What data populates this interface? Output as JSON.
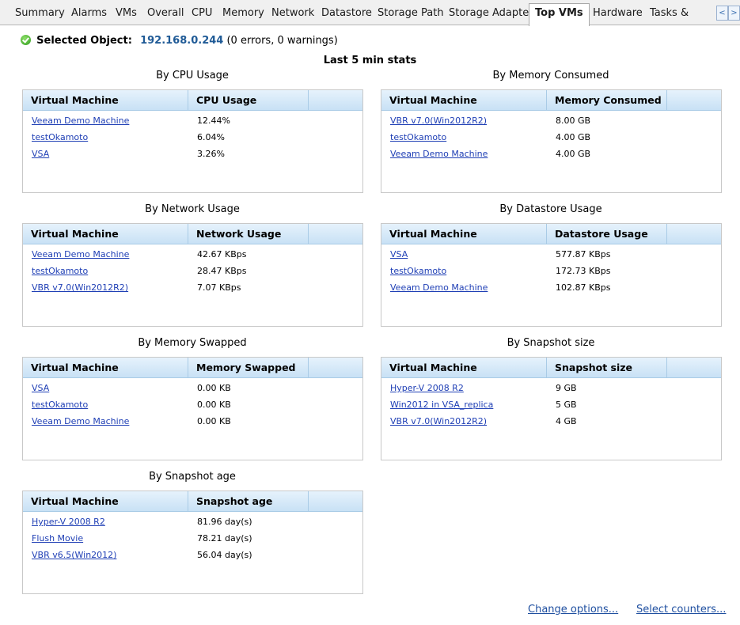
{
  "tabs": [
    {
      "label": "Summary",
      "active": false
    },
    {
      "label": "Alarms",
      "active": false
    },
    {
      "label": "VMs",
      "active": false
    },
    {
      "label": "Overall",
      "active": false
    },
    {
      "label": "CPU",
      "active": false
    },
    {
      "label": "Memory",
      "active": false
    },
    {
      "label": "Network",
      "active": false
    },
    {
      "label": "Datastore",
      "active": false
    },
    {
      "label": "Storage Path",
      "active": false
    },
    {
      "label": "Storage Adapter",
      "active": false
    },
    {
      "label": "Top VMs",
      "active": true
    },
    {
      "label": "Hardware",
      "active": false
    },
    {
      "label": "Tasks &",
      "active": false
    }
  ],
  "scroll": {
    "left": "<",
    "right": ">"
  },
  "selected_object": {
    "label": "Selected Object:",
    "ip": "192.168.0.244",
    "status": "(0 errors, 0 warnings)"
  },
  "stats_title": "Last 5 min stats",
  "panels": [
    {
      "title": "By CPU Usage",
      "col1": "Virtual Machine",
      "col2": "CPU Usage",
      "rows": [
        {
          "vm": "Veeam Demo Machine",
          "value": "12.44%"
        },
        {
          "vm": "testOkamoto",
          "value": "6.04%"
        },
        {
          "vm": "VSA",
          "value": "3.26%"
        }
      ]
    },
    {
      "title": "By Memory Consumed",
      "col1": "Virtual Machine",
      "col2": "Memory Consumed",
      "rows": [
        {
          "vm": "VBR v7.0(Win2012R2)",
          "value": "8.00 GB"
        },
        {
          "vm": "testOkamoto",
          "value": "4.00 GB"
        },
        {
          "vm": "Veeam Demo Machine",
          "value": "4.00 GB"
        }
      ]
    },
    {
      "title": "By Network Usage",
      "col1": "Virtual Machine",
      "col2": "Network Usage",
      "rows": [
        {
          "vm": "Veeam Demo Machine",
          "value": "42.67 KBps"
        },
        {
          "vm": "testOkamoto",
          "value": "28.47 KBps"
        },
        {
          "vm": "VBR v7.0(Win2012R2)",
          "value": "7.07 KBps"
        }
      ]
    },
    {
      "title": "By Datastore Usage",
      "col1": "Virtual Machine",
      "col2": "Datastore Usage",
      "rows": [
        {
          "vm": "VSA",
          "value": "577.87 KBps"
        },
        {
          "vm": "testOkamoto",
          "value": "172.73 KBps"
        },
        {
          "vm": "Veeam Demo Machine",
          "value": "102.87 KBps"
        }
      ]
    },
    {
      "title": "By Memory Swapped",
      "col1": "Virtual Machine",
      "col2": "Memory Swapped",
      "rows": [
        {
          "vm": "VSA",
          "value": "0.00 KB"
        },
        {
          "vm": "testOkamoto",
          "value": "0.00 KB"
        },
        {
          "vm": "Veeam Demo Machine",
          "value": "0.00 KB"
        }
      ]
    },
    {
      "title": "By Snapshot size",
      "col1": "Virtual Machine",
      "col2": "Snapshot size",
      "rows": [
        {
          "vm": "Hyper-V 2008 R2",
          "value": "9 GB"
        },
        {
          "vm": "Win2012 in VSA_replica",
          "value": "5 GB"
        },
        {
          "vm": "VBR v7.0(Win2012R2)",
          "value": "4 GB"
        }
      ]
    },
    {
      "title": "By Snapshot age",
      "col1": "Virtual Machine",
      "col2": "Snapshot age",
      "rows": [
        {
          "vm": "Hyper-V 2008 R2",
          "value": "81.96 day(s)"
        },
        {
          "vm": "Flush Movie",
          "value": "78.21 day(s)"
        },
        {
          "vm": "VBR v6.5(Win2012)",
          "value": "56.04 day(s)"
        }
      ]
    }
  ],
  "footer": {
    "change_options": "Change options...",
    "select_counters": "Select counters..."
  }
}
